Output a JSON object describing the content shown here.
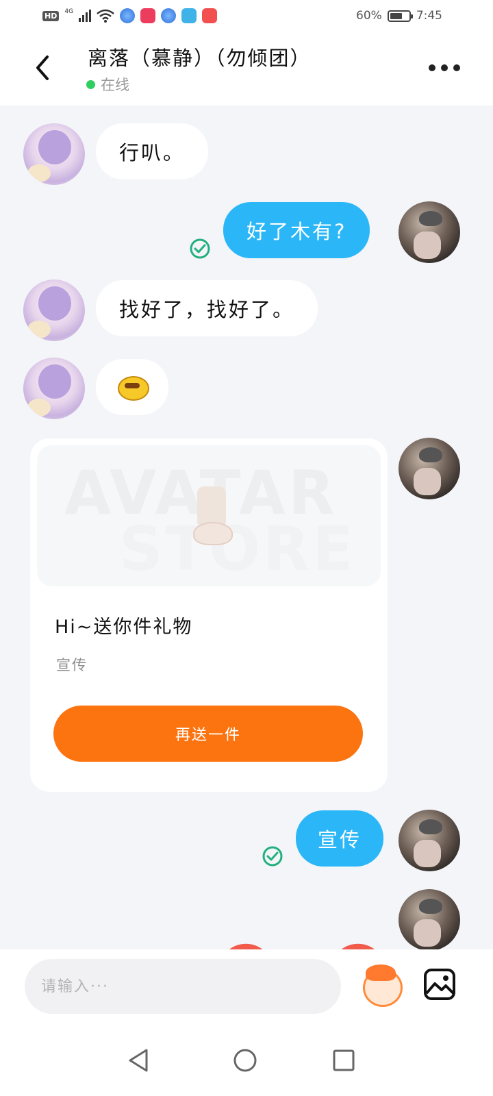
{
  "status_bar": {
    "hd": "HD",
    "network": "4G",
    "battery": "60%",
    "time": "7:45"
  },
  "header": {
    "title": "离落（慕静）（勿倾团）",
    "status": "在线"
  },
  "messages": [
    {
      "from": "contact",
      "text": "行叭。"
    },
    {
      "from": "me",
      "text": "好了木有?"
    },
    {
      "from": "contact",
      "text": "找好了，找好了。"
    },
    {
      "from": "contact",
      "type": "sticker",
      "icon": "yellow-face-sticker"
    },
    {
      "from": "me",
      "type": "gift",
      "title": "Hi~送你件礼物",
      "desc": "宣传",
      "button": "再送一件"
    },
    {
      "from": "me",
      "text": "宣传"
    },
    {
      "from": "me",
      "type": "sticker",
      "icon": "heart-sticker"
    }
  ],
  "input": {
    "placeholder": "请输入···"
  },
  "colors": {
    "outgoing_bubble": "#2bb7f7",
    "gift_button": "#fb7410",
    "online_dot": "#2ecf5f",
    "read_check": "#22b07d"
  }
}
